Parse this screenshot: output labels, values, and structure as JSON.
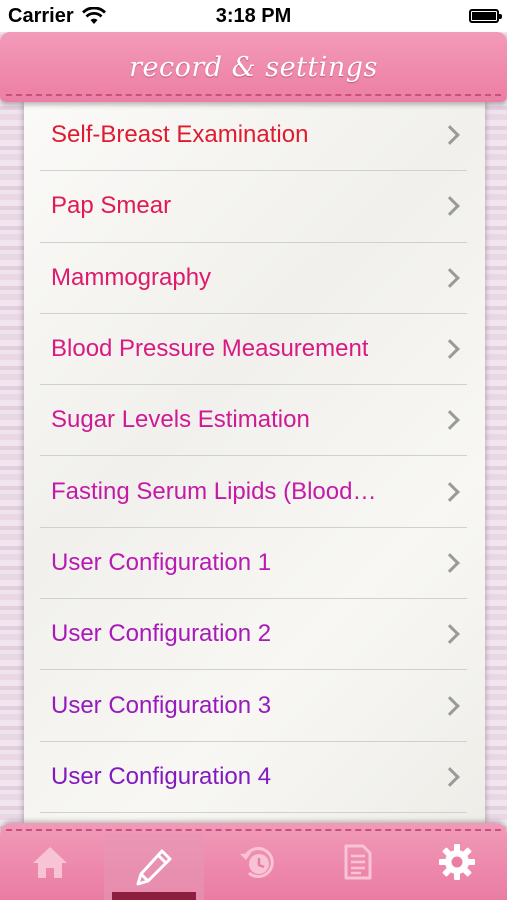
{
  "status": {
    "carrier": "Carrier",
    "time": "3:18 PM"
  },
  "header": {
    "title": "record & settings"
  },
  "items": [
    {
      "label": "Self-Breast Examination",
      "color": "#e01b2f"
    },
    {
      "label": "Pap Smear",
      "color": "#e01a52"
    },
    {
      "label": "Mammography",
      "color": "#dd1a6c"
    },
    {
      "label": "Blood Pressure Measurement",
      "color": "#d91a82"
    },
    {
      "label": "Sugar Levels Estimation",
      "color": "#cf1a95"
    },
    {
      "label": "Fasting Serum Lipids (Blood…",
      "color": "#c51aa5"
    },
    {
      "label": "User Configuration 1",
      "color": "#b81ab2"
    },
    {
      "label": "User Configuration 2",
      "color": "#a81ab8"
    },
    {
      "label": "User Configuration 3",
      "color": "#961abd"
    },
    {
      "label": "User Configuration 4",
      "color": "#821ac0"
    }
  ],
  "tabs": [
    {
      "name": "home-icon",
      "active": false
    },
    {
      "name": "pencil-icon",
      "active": true
    },
    {
      "name": "history-clock-icon",
      "active": false
    },
    {
      "name": "document-icon",
      "active": false
    },
    {
      "name": "gear-icon",
      "active": false
    }
  ],
  "colors": {
    "accent": "#ec7ea4",
    "active_indicator": "#8d1e3f"
  }
}
